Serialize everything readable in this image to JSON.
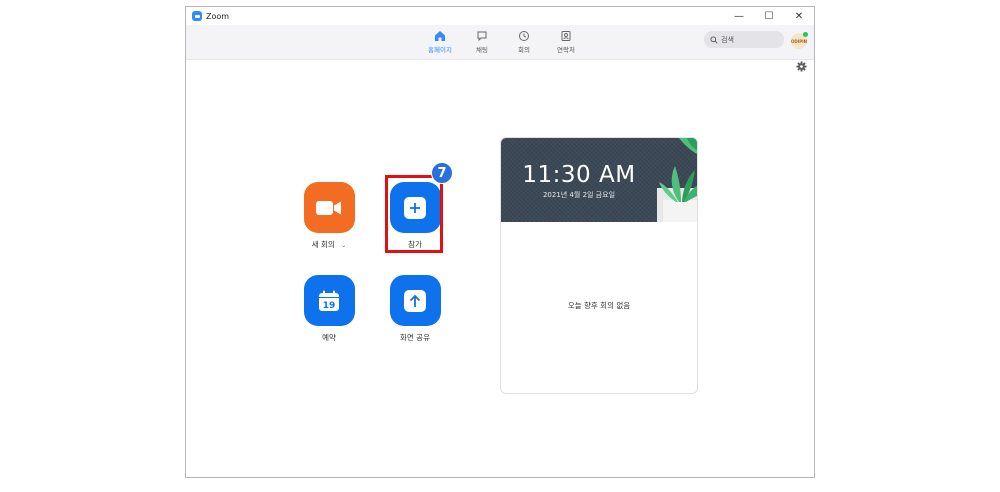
{
  "window": {
    "title": "Zoom",
    "controls": {
      "minimize": "—",
      "maximize": "☐",
      "close": "✕"
    }
  },
  "nav": {
    "items": [
      {
        "label": "홈페이지",
        "icon": "home-icon",
        "active": true
      },
      {
        "label": "채팅",
        "icon": "chat-icon",
        "active": false
      },
      {
        "label": "회의",
        "icon": "clock-icon",
        "active": false
      },
      {
        "label": "연락처",
        "icon": "contacts-icon",
        "active": false
      }
    ]
  },
  "search": {
    "placeholder": "검색"
  },
  "avatar": {
    "text": "ODIPIN"
  },
  "actions": {
    "new_meeting": {
      "label": "새 회의",
      "icon": "video-camera-icon"
    },
    "join": {
      "label": "참가",
      "icon": "plus-icon"
    },
    "schedule": {
      "label": "예약",
      "icon": "calendar-icon",
      "calendar_day": "19"
    },
    "share_screen": {
      "label": "화면 공유",
      "icon": "upload-arrow-icon"
    }
  },
  "annotation": {
    "step_number": "7"
  },
  "card": {
    "time": "11:30 AM",
    "date": "2021년 4월 2일 금요일",
    "empty_message": "오늘 향후 회의 없음"
  },
  "colors": {
    "accent_blue": "#0e72ed",
    "orange": "#f26d21",
    "highlight_red": "#e11111",
    "card_header": "#3b4856"
  }
}
